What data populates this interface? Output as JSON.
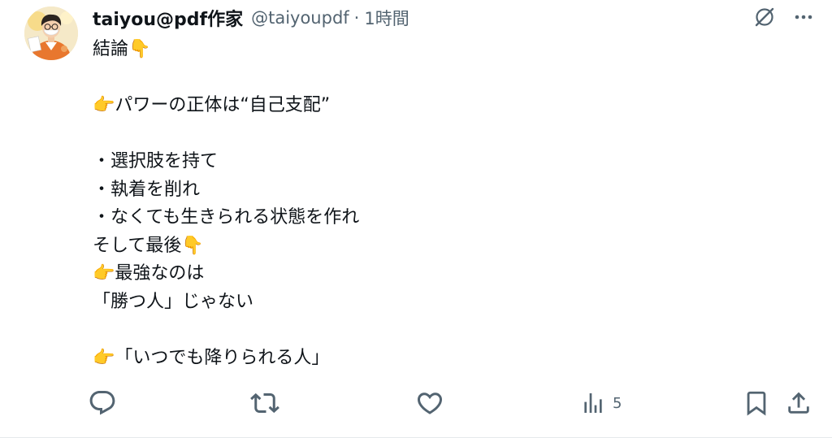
{
  "post": {
    "display_name": "taiyou@pdf作家",
    "handle": "@taiyoupdf",
    "separator": "·",
    "time": "1時間",
    "lines": [
      "結論👇",
      "",
      "👉パワーの正体は“自己支配”",
      "",
      "・選択肢を持て",
      "・執着を削れ",
      "・なくても生きられる状態を作れ",
      "そして最後👇",
      "👉最強なのは",
      "「勝つ人」じゃない",
      "",
      "👉「いつでも降りられる人」"
    ]
  },
  "actions": {
    "views_count": "5"
  },
  "colors": {
    "text": "#0f1419",
    "secondary": "#536471"
  },
  "icons": [
    "avatar",
    "grok-icon",
    "more-icon",
    "reply-icon",
    "repost-icon",
    "like-icon",
    "views-icon",
    "bookmark-icon",
    "share-icon"
  ]
}
